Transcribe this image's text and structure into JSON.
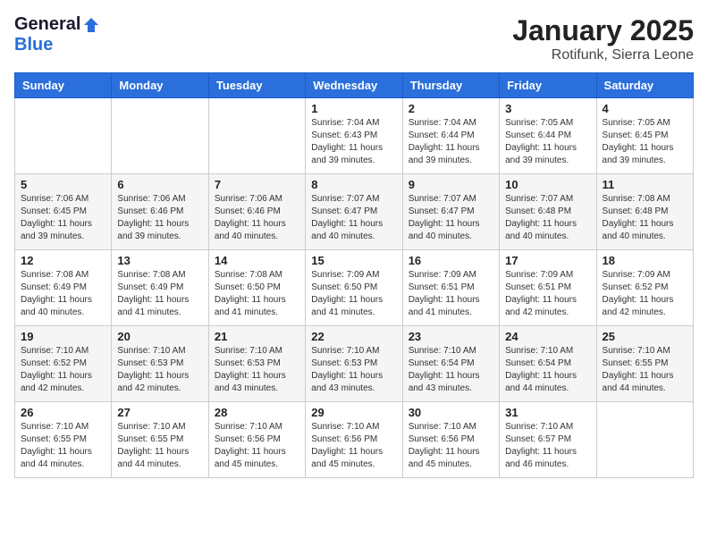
{
  "logo": {
    "general": "General",
    "blue": "Blue"
  },
  "header": {
    "month": "January 2025",
    "location": "Rotifunk, Sierra Leone"
  },
  "weekdays": [
    "Sunday",
    "Monday",
    "Tuesday",
    "Wednesday",
    "Thursday",
    "Friday",
    "Saturday"
  ],
  "weeks": [
    [
      {
        "day": "",
        "sunrise": "",
        "sunset": "",
        "daylight": ""
      },
      {
        "day": "",
        "sunrise": "",
        "sunset": "",
        "daylight": ""
      },
      {
        "day": "",
        "sunrise": "",
        "sunset": "",
        "daylight": ""
      },
      {
        "day": "1",
        "sunrise": "Sunrise: 7:04 AM",
        "sunset": "Sunset: 6:43 PM",
        "daylight": "Daylight: 11 hours and 39 minutes."
      },
      {
        "day": "2",
        "sunrise": "Sunrise: 7:04 AM",
        "sunset": "Sunset: 6:44 PM",
        "daylight": "Daylight: 11 hours and 39 minutes."
      },
      {
        "day": "3",
        "sunrise": "Sunrise: 7:05 AM",
        "sunset": "Sunset: 6:44 PM",
        "daylight": "Daylight: 11 hours and 39 minutes."
      },
      {
        "day": "4",
        "sunrise": "Sunrise: 7:05 AM",
        "sunset": "Sunset: 6:45 PM",
        "daylight": "Daylight: 11 hours and 39 minutes."
      }
    ],
    [
      {
        "day": "5",
        "sunrise": "Sunrise: 7:06 AM",
        "sunset": "Sunset: 6:45 PM",
        "daylight": "Daylight: 11 hours and 39 minutes."
      },
      {
        "day": "6",
        "sunrise": "Sunrise: 7:06 AM",
        "sunset": "Sunset: 6:46 PM",
        "daylight": "Daylight: 11 hours and 39 minutes."
      },
      {
        "day": "7",
        "sunrise": "Sunrise: 7:06 AM",
        "sunset": "Sunset: 6:46 PM",
        "daylight": "Daylight: 11 hours and 40 minutes."
      },
      {
        "day": "8",
        "sunrise": "Sunrise: 7:07 AM",
        "sunset": "Sunset: 6:47 PM",
        "daylight": "Daylight: 11 hours and 40 minutes."
      },
      {
        "day": "9",
        "sunrise": "Sunrise: 7:07 AM",
        "sunset": "Sunset: 6:47 PM",
        "daylight": "Daylight: 11 hours and 40 minutes."
      },
      {
        "day": "10",
        "sunrise": "Sunrise: 7:07 AM",
        "sunset": "Sunset: 6:48 PM",
        "daylight": "Daylight: 11 hours and 40 minutes."
      },
      {
        "day": "11",
        "sunrise": "Sunrise: 7:08 AM",
        "sunset": "Sunset: 6:48 PM",
        "daylight": "Daylight: 11 hours and 40 minutes."
      }
    ],
    [
      {
        "day": "12",
        "sunrise": "Sunrise: 7:08 AM",
        "sunset": "Sunset: 6:49 PM",
        "daylight": "Daylight: 11 hours and 40 minutes."
      },
      {
        "day": "13",
        "sunrise": "Sunrise: 7:08 AM",
        "sunset": "Sunset: 6:49 PM",
        "daylight": "Daylight: 11 hours and 41 minutes."
      },
      {
        "day": "14",
        "sunrise": "Sunrise: 7:08 AM",
        "sunset": "Sunset: 6:50 PM",
        "daylight": "Daylight: 11 hours and 41 minutes."
      },
      {
        "day": "15",
        "sunrise": "Sunrise: 7:09 AM",
        "sunset": "Sunset: 6:50 PM",
        "daylight": "Daylight: 11 hours and 41 minutes."
      },
      {
        "day": "16",
        "sunrise": "Sunrise: 7:09 AM",
        "sunset": "Sunset: 6:51 PM",
        "daylight": "Daylight: 11 hours and 41 minutes."
      },
      {
        "day": "17",
        "sunrise": "Sunrise: 7:09 AM",
        "sunset": "Sunset: 6:51 PM",
        "daylight": "Daylight: 11 hours and 42 minutes."
      },
      {
        "day": "18",
        "sunrise": "Sunrise: 7:09 AM",
        "sunset": "Sunset: 6:52 PM",
        "daylight": "Daylight: 11 hours and 42 minutes."
      }
    ],
    [
      {
        "day": "19",
        "sunrise": "Sunrise: 7:10 AM",
        "sunset": "Sunset: 6:52 PM",
        "daylight": "Daylight: 11 hours and 42 minutes."
      },
      {
        "day": "20",
        "sunrise": "Sunrise: 7:10 AM",
        "sunset": "Sunset: 6:53 PM",
        "daylight": "Daylight: 11 hours and 42 minutes."
      },
      {
        "day": "21",
        "sunrise": "Sunrise: 7:10 AM",
        "sunset": "Sunset: 6:53 PM",
        "daylight": "Daylight: 11 hours and 43 minutes."
      },
      {
        "day": "22",
        "sunrise": "Sunrise: 7:10 AM",
        "sunset": "Sunset: 6:53 PM",
        "daylight": "Daylight: 11 hours and 43 minutes."
      },
      {
        "day": "23",
        "sunrise": "Sunrise: 7:10 AM",
        "sunset": "Sunset: 6:54 PM",
        "daylight": "Daylight: 11 hours and 43 minutes."
      },
      {
        "day": "24",
        "sunrise": "Sunrise: 7:10 AM",
        "sunset": "Sunset: 6:54 PM",
        "daylight": "Daylight: 11 hours and 44 minutes."
      },
      {
        "day": "25",
        "sunrise": "Sunrise: 7:10 AM",
        "sunset": "Sunset: 6:55 PM",
        "daylight": "Daylight: 11 hours and 44 minutes."
      }
    ],
    [
      {
        "day": "26",
        "sunrise": "Sunrise: 7:10 AM",
        "sunset": "Sunset: 6:55 PM",
        "daylight": "Daylight: 11 hours and 44 minutes."
      },
      {
        "day": "27",
        "sunrise": "Sunrise: 7:10 AM",
        "sunset": "Sunset: 6:55 PM",
        "daylight": "Daylight: 11 hours and 44 minutes."
      },
      {
        "day": "28",
        "sunrise": "Sunrise: 7:10 AM",
        "sunset": "Sunset: 6:56 PM",
        "daylight": "Daylight: 11 hours and 45 minutes."
      },
      {
        "day": "29",
        "sunrise": "Sunrise: 7:10 AM",
        "sunset": "Sunset: 6:56 PM",
        "daylight": "Daylight: 11 hours and 45 minutes."
      },
      {
        "day": "30",
        "sunrise": "Sunrise: 7:10 AM",
        "sunset": "Sunset: 6:56 PM",
        "daylight": "Daylight: 11 hours and 45 minutes."
      },
      {
        "day": "31",
        "sunrise": "Sunrise: 7:10 AM",
        "sunset": "Sunset: 6:57 PM",
        "daylight": "Daylight: 11 hours and 46 minutes."
      },
      {
        "day": "",
        "sunrise": "",
        "sunset": "",
        "daylight": ""
      }
    ]
  ]
}
